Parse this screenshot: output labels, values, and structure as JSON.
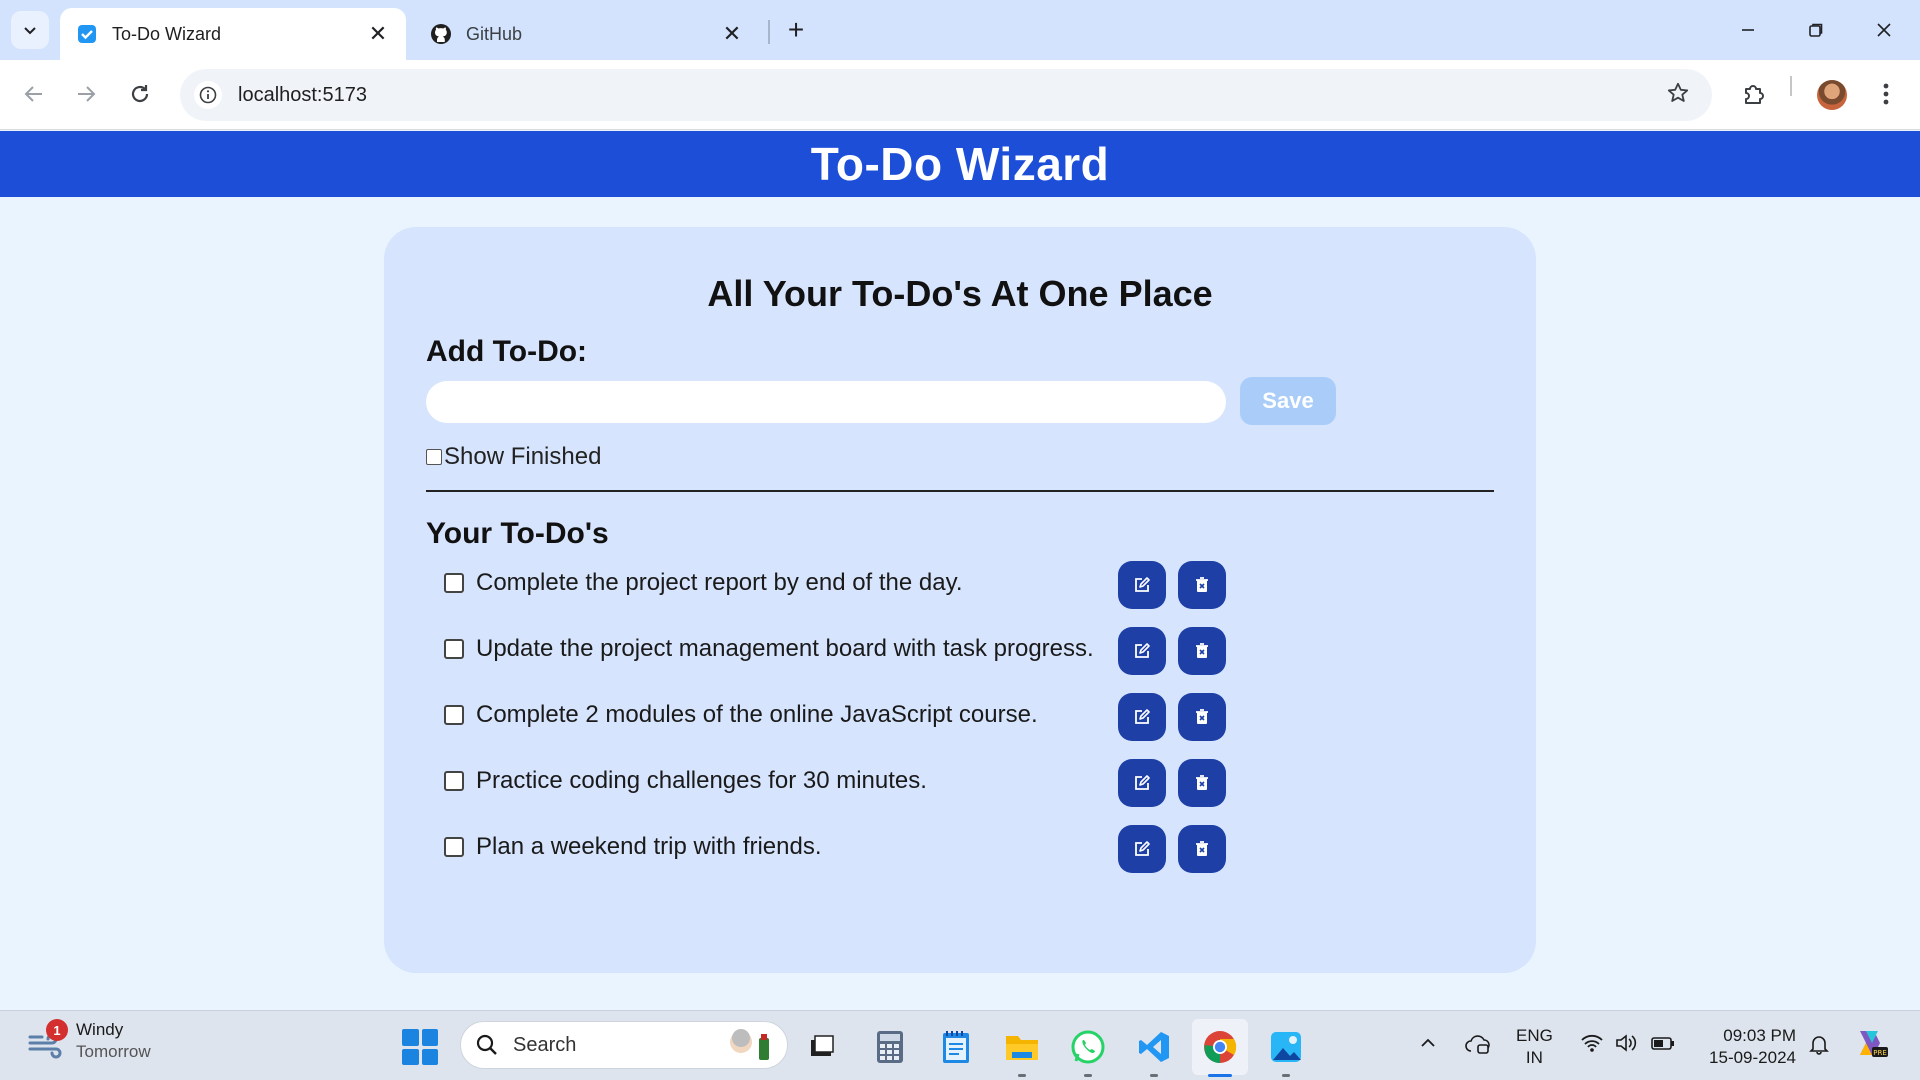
{
  "browser": {
    "tabs": [
      {
        "title": "To-Do Wizard",
        "icon": "checkbox-favicon-icon",
        "active": true
      },
      {
        "title": "GitHub",
        "icon": "github-icon",
        "active": false
      }
    ],
    "url": "localhost:5173"
  },
  "app": {
    "header_title": "To-Do Wizard",
    "card_title": "All Your To-Do's At One Place",
    "add_label": "Add To-Do:",
    "input_value": "",
    "input_placeholder": "",
    "save_label": "Save",
    "show_finished_label": "Show Finished",
    "show_finished_checked": false,
    "list_title": "Your To-Do's",
    "todos": [
      {
        "text": "Complete the project report by end of the day.",
        "done": false
      },
      {
        "text": "Update the project management board with task progress.",
        "done": false
      },
      {
        "text": "Complete 2 modules of the online JavaScript course.",
        "done": false
      },
      {
        "text": "Practice coding challenges for 30 minutes.",
        "done": false
      },
      {
        "text": "Plan a weekend trip with friends.",
        "done": false
      }
    ],
    "colors": {
      "header": "#1d4ed8",
      "card": "#d6e4fd",
      "action_button": "#1e3fa6",
      "save_button": "#a9cdf8"
    }
  },
  "taskbar": {
    "weather": {
      "title": "Windy",
      "subtitle": "Tomorrow",
      "badge": "1"
    },
    "search_label": "Search",
    "language": {
      "line1": "ENG",
      "line2": "IN"
    },
    "time": "09:03 PM",
    "date": "15-09-2024"
  }
}
